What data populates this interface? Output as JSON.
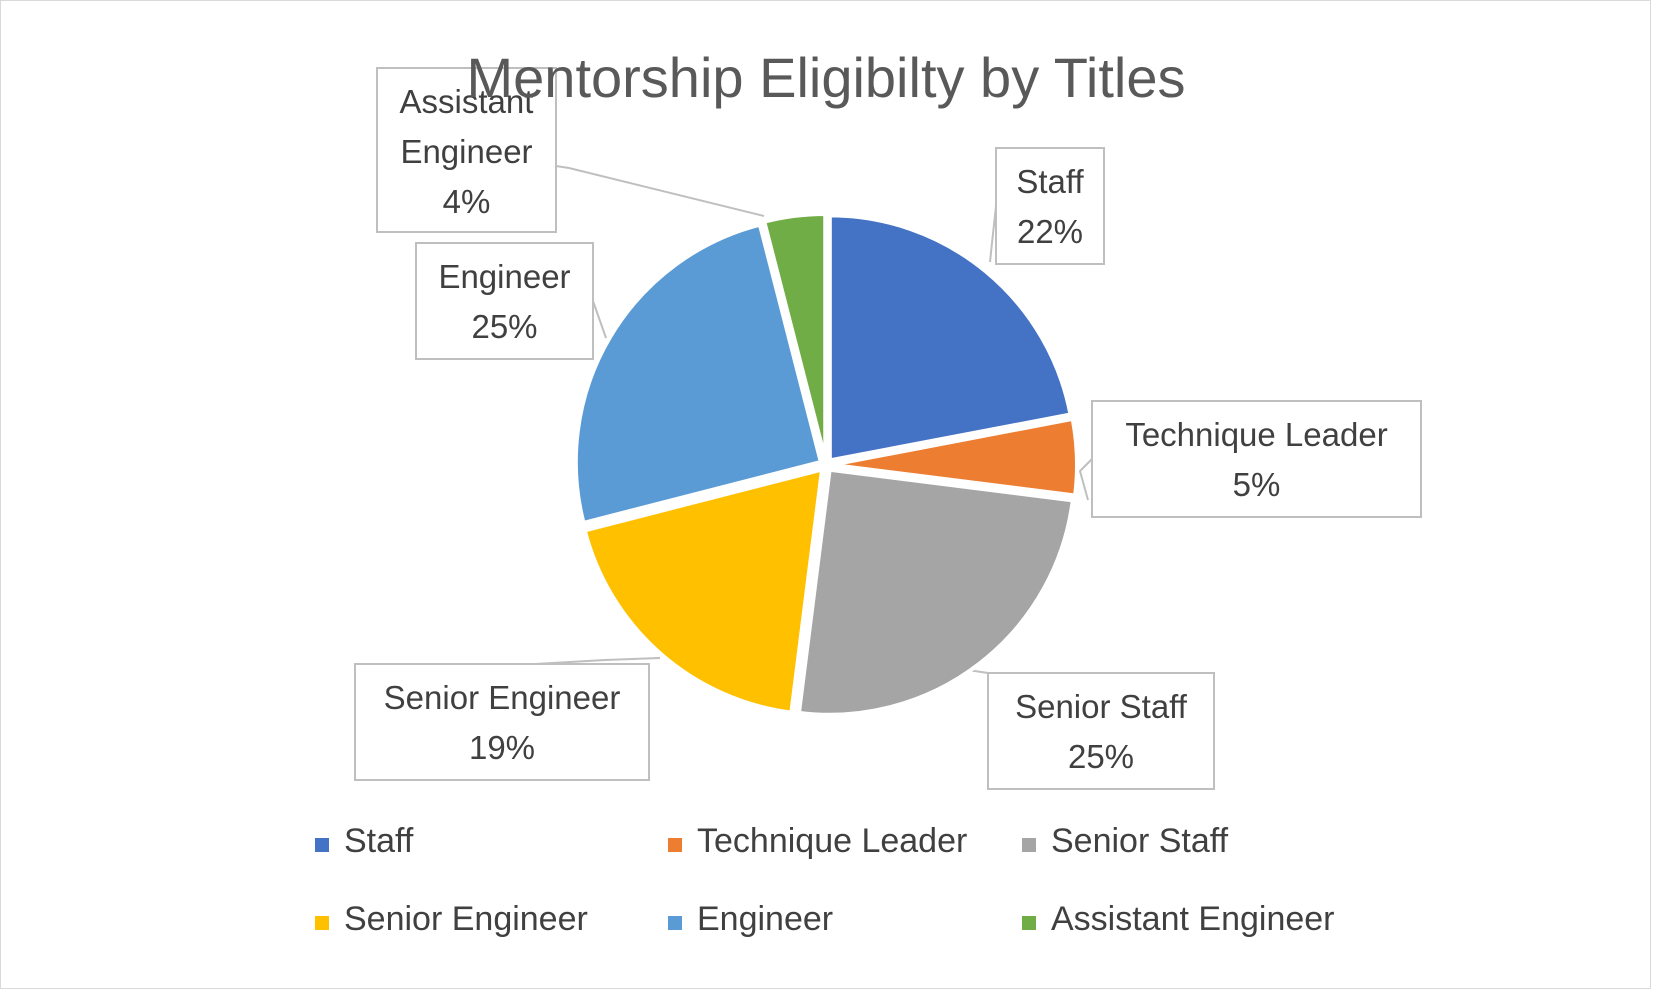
{
  "chart_data": {
    "type": "pie",
    "title": "Mentorship Eligibilty by Titles",
    "legend_position": "bottom",
    "slices": [
      {
        "name": "Staff",
        "value": 22,
        "label": "22%",
        "color": "#4472C4"
      },
      {
        "name": "Technique Leader",
        "value": 5,
        "label": "5%",
        "color": "#ED7D31"
      },
      {
        "name": "Senior Staff",
        "value": 25,
        "label": "25%",
        "color": "#A5A5A5"
      },
      {
        "name": "Senior Engineer",
        "value": 19,
        "label": "19%",
        "color": "#FFC000"
      },
      {
        "name": "Engineer",
        "value": 25,
        "label": "25%",
        "color": "#5B9BD5"
      },
      {
        "name": "Assistant Engineer",
        "value": 4,
        "label": "4%",
        "color": "#70AD47"
      }
    ]
  }
}
